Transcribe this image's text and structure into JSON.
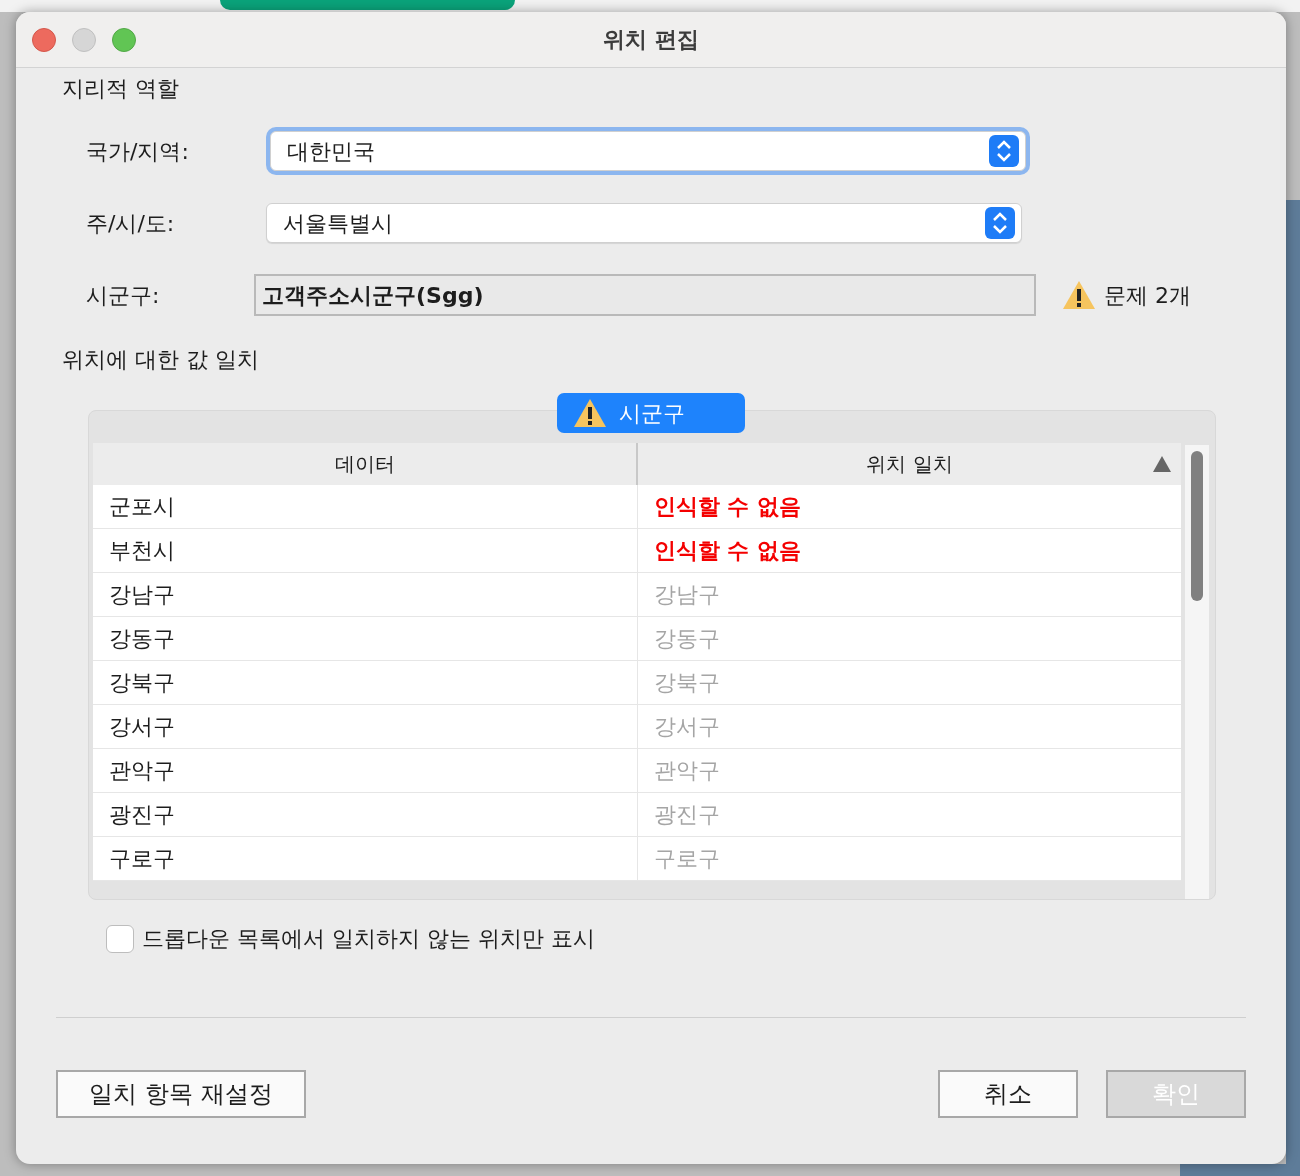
{
  "window": {
    "title": "위치 편집"
  },
  "geo_section": {
    "title": "지리적 역할"
  },
  "fields": [
    {
      "kind": "select",
      "label": "국가/지역:",
      "value": "대한민국",
      "focused": true
    },
    {
      "kind": "select",
      "label": "주/시/도:",
      "value": "서울특별시",
      "focused": false
    },
    {
      "kind": "text",
      "label": "시군구:",
      "value": "고객주소시군구(Sgg)",
      "issues": "문제 2개"
    }
  ],
  "match_section": {
    "title": "위치에 대한 값 일치",
    "tab": "시군구"
  },
  "table": {
    "columns": [
      {
        "label": "데이터",
        "sorted": false
      },
      {
        "label": "위치 일치",
        "sorted": true
      }
    ],
    "rows": [
      {
        "data": "군포시",
        "match": "인식할 수 없음",
        "kind": "unrecognized"
      },
      {
        "data": "부천시",
        "match": "인식할 수 없음",
        "kind": "unrecognized"
      },
      {
        "data": "강남구",
        "match": "강남구",
        "kind": "matched"
      },
      {
        "data": "강동구",
        "match": "강동구",
        "kind": "matched"
      },
      {
        "data": "강북구",
        "match": "강북구",
        "kind": "matched"
      },
      {
        "data": "강서구",
        "match": "강서구",
        "kind": "matched"
      },
      {
        "data": "관악구",
        "match": "관악구",
        "kind": "matched"
      },
      {
        "data": "광진구",
        "match": "광진구",
        "kind": "matched"
      },
      {
        "data": "구로구",
        "match": "구로구",
        "kind": "matched"
      }
    ]
  },
  "filter_checkbox": {
    "label": "드롭다운 목록에서 일치하지 않는 위치만 표시",
    "checked": false
  },
  "buttons": [
    {
      "label": "일치 항목 재설정",
      "disabled": false
    },
    {
      "label": "취소",
      "disabled": false
    },
    {
      "label": "확인",
      "disabled": true
    }
  ]
}
